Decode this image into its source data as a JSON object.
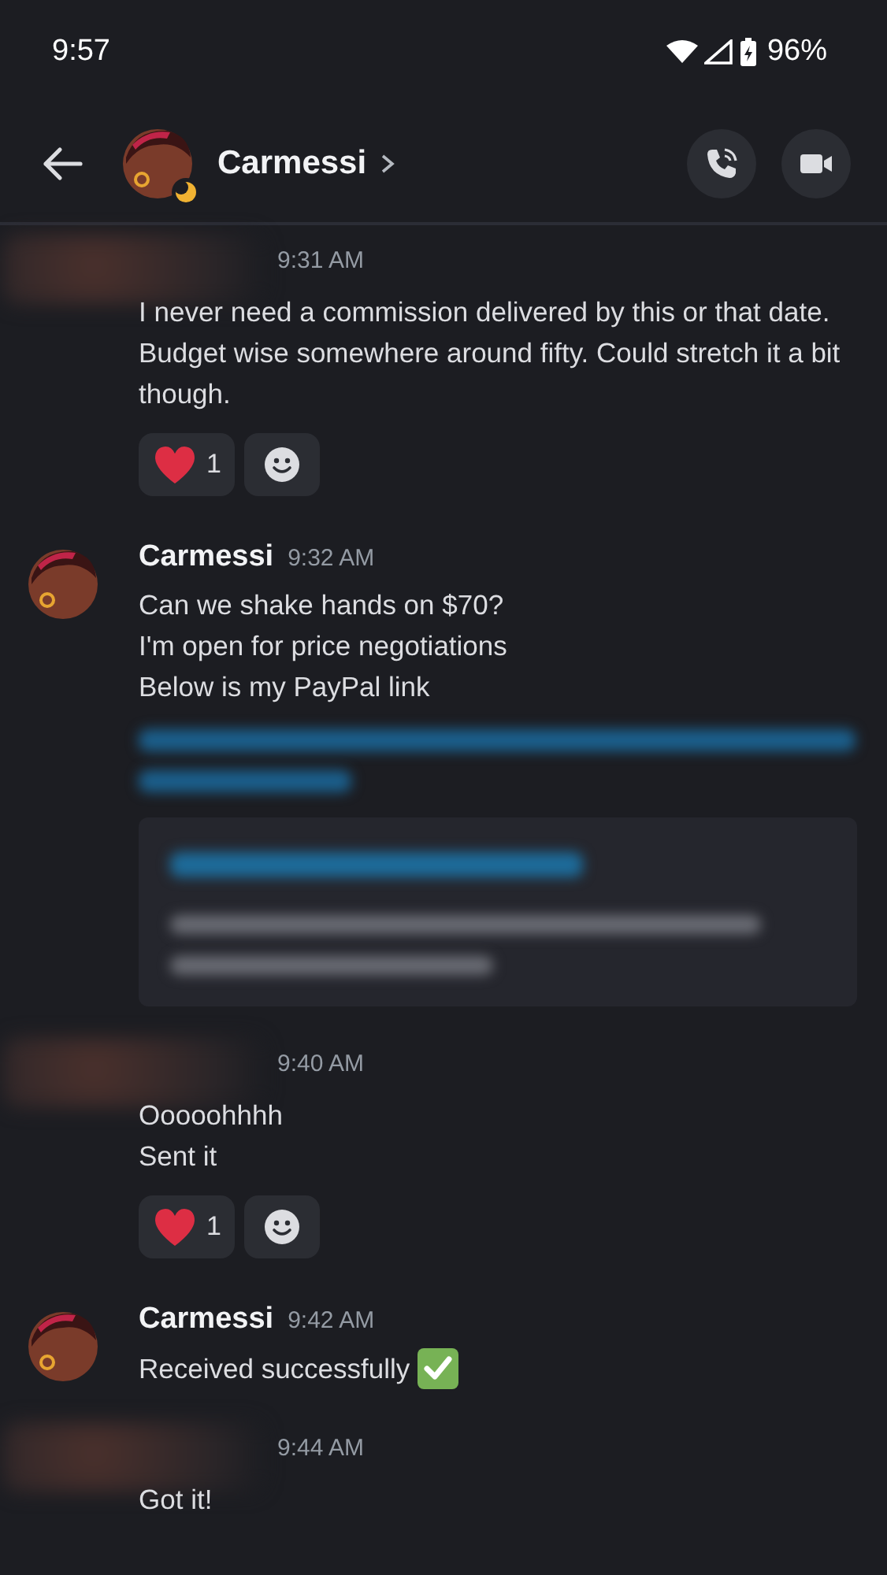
{
  "status_bar": {
    "time": "9:57",
    "battery": "96%"
  },
  "header": {
    "title": "Carmessi",
    "idle": true
  },
  "messages": [
    {
      "kind": "redacted",
      "time": "9:31 AM",
      "lines": [
        "I never need a commission delivered by this or that date. Budget wise somewhere around fifty. Could stretch it a bit though."
      ],
      "reactions": [
        {
          "count": "1"
        }
      ]
    },
    {
      "kind": "named",
      "author": "Carmessi",
      "time": "9:32 AM",
      "lines": [
        "Can we shake hands on $70?",
        "I'm open for price negotiations",
        "Below is my PayPal link"
      ],
      "redacted_link": true
    },
    {
      "kind": "redacted",
      "time": "9:40 AM",
      "lines": [
        "Ooooohhhh",
        "Sent it"
      ],
      "reactions": [
        {
          "count": "1"
        }
      ]
    },
    {
      "kind": "named",
      "author": "Carmessi",
      "time": "9:42 AM",
      "lines": [
        "Received successfully"
      ],
      "checkmark": true
    },
    {
      "kind": "redacted",
      "time": "9:44 AM",
      "lines": [
        "Got it!"
      ]
    }
  ]
}
